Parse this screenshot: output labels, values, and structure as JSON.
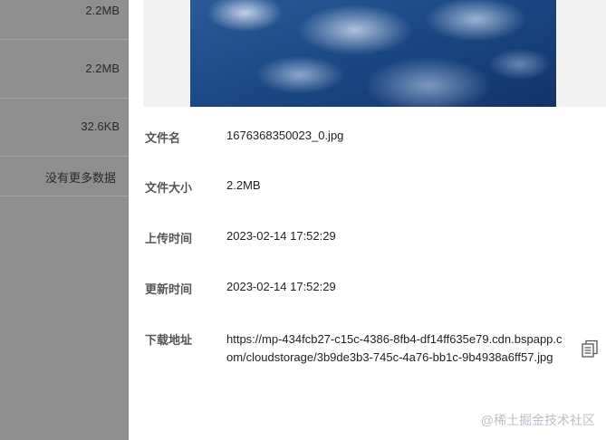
{
  "file_list": {
    "rows": [
      {
        "size": "2.2MB"
      },
      {
        "size": "2.2MB"
      },
      {
        "size": "32.6KB"
      }
    ],
    "no_more_text": "没有更多数据"
  },
  "detail": {
    "fields": [
      {
        "label": "文件名",
        "value": "1676368350023_0.jpg"
      },
      {
        "label": "文件大小",
        "value": "2.2MB"
      },
      {
        "label": "上传时间",
        "value": "2023-02-14 17:52:29"
      },
      {
        "label": "更新时间",
        "value": "2023-02-14 17:52:29"
      }
    ],
    "download": {
      "label": "下载地址",
      "url": "https://mp-434fcb27-c15c-4386-8fb4-df14ff635e79.cdn.bspapp.com/cloudstorage/3b9de3b3-745c-4a76-bb1c-9b4938a6ff57.jpg"
    }
  },
  "watermark": "@稀土掘金技术社区",
  "icons": {
    "copy": "copy-icon"
  }
}
